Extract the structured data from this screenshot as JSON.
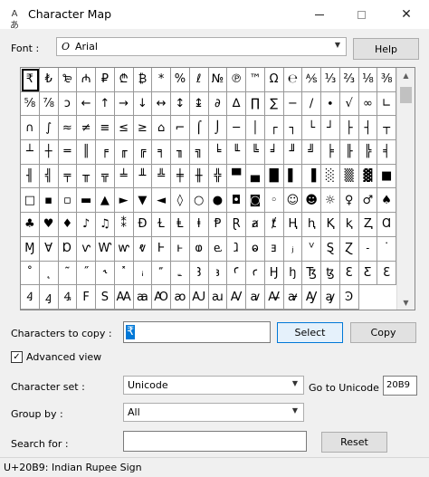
{
  "window": {
    "title": "Character Map",
    "icon": "character-map-icon",
    "controls": [
      "minimize",
      "maximize",
      "close"
    ]
  },
  "font_row": {
    "label": "Font :",
    "font_icon": "O",
    "value": "Arial",
    "help_label": "Help"
  },
  "grid": {
    "selected_index": 0,
    "rows": [
      [
        "₹",
        "₺",
        "₻",
        "₼",
        "₽",
        "₾",
        "₿",
        "*",
        "%",
        "ℓ",
        "№",
        "℗",
        "™",
        "Ω",
        "℮",
        "⅍",
        "⅓",
        "⅔",
        "⅛"
      ],
      [
        "⅜",
        "⅝",
        "⅞",
        "ↄ",
        "←",
        "↑",
        "→",
        "↓",
        "↔",
        "↕",
        "↨",
        "∂",
        "∆",
        "∏",
        "∑",
        "−",
        "∕",
        "∙",
        "√",
        "∞"
      ],
      [
        "∟",
        "∩",
        "∫",
        "≈",
        "≠",
        "≡",
        "≤",
        "≥",
        "⌂",
        "⌐",
        "⌠",
        "⌡",
        "─",
        "│",
        "┌",
        "┐",
        "└",
        "┘",
        "├",
        "┤"
      ],
      [
        "┬",
        "┴",
        "┼",
        "═",
        "║",
        "╒",
        "╓",
        "╔",
        "╕",
        "╖",
        "╗",
        "╘",
        "╙",
        "╚",
        "╛",
        "╜",
        "╝",
        "╞",
        "╟",
        "╠"
      ],
      [
        "╡",
        "╢",
        "╣",
        "╤",
        "╥",
        "╦",
        "╧",
        "╨",
        "╩",
        "╪",
        "╫",
        "╬",
        "▀",
        "▄",
        "█",
        "▌",
        "▐",
        "░",
        "▒",
        "▓"
      ],
      [
        "■",
        "□",
        "▪",
        "▫",
        "▬",
        "▲",
        "►",
        "▼",
        "◄",
        "◊",
        "○",
        "●",
        "◘",
        "◙",
        "◦",
        "☺",
        "☻",
        "☼",
        "♀"
      ],
      [
        "♂",
        "♠",
        "♣",
        "♥",
        "♦",
        "♪",
        "♫",
        "⁑",
        "Ɖ",
        "Ɫ",
        "Ⱡ",
        "ⱡ",
        "Ᵽ",
        "Ɽ",
        "ⱥ",
        "ⱦ",
        "Ⱨ",
        "ⱨ",
        "Ⱪ",
        "ⱪ"
      ],
      [
        "Ⱬ",
        "Ɑ",
        "Ɱ",
        "Ɐ",
        "Ɒ",
        "ⱱ",
        "Ⱳ",
        "ⱳ",
        "ⱴ",
        "Ⱶ",
        "ⱶ",
        "ⱷ",
        "ⱸ",
        "ⱹ",
        "ⱺ",
        "ⱻ",
        "ⱼ",
        "ⱽ",
        "Ȿ",
        "Ɀ"
      ],
      [
        "˗",
        "˙",
        "˚",
        "˛",
        "˜",
        "˝",
        "˞",
        "˟",
        "ꜟ",
        "꜠",
        "꜡",
        "Ꜣ",
        "ꜣ",
        "Ꜥ",
        "ꜥ",
        "Ꜧ",
        "ꜧ",
        "Ꜩ",
        "ꜩ",
        "Ꜫ"
      ],
      [
        "Ƹ",
        "Ɛ",
        "Ꜭ",
        "ꜭ",
        "Ꜯ",
        "F",
        "S",
        "Ꜳ",
        "ꜳ",
        "Ꜵ",
        "ꜵ",
        "Ꜷ",
        "ꜷ",
        "Ꜹ",
        "ꜹ",
        "Ꜻ",
        "ꜻ",
        "Ꜽ",
        "ꜽ",
        "Ꜿ"
      ]
    ]
  },
  "copy_row": {
    "label": "Characters to copy :",
    "value": "₹",
    "select_label": "Select",
    "copy_label": "Copy"
  },
  "advanced_view": {
    "label": "Advanced view",
    "checked": true,
    "check_glyph": "✓"
  },
  "character_set": {
    "label": "Character set :",
    "value": "Unicode",
    "goto_label": "Go to Unicode :",
    "goto_value": "20B9"
  },
  "group_by": {
    "label": "Group by :",
    "value": "All"
  },
  "search": {
    "label": "Search for :",
    "value": "",
    "reset_label": "Reset"
  },
  "status": {
    "text": "U+20B9: Indian Rupee Sign"
  },
  "glyphs": {
    "dropdown_arrow": "▼",
    "scroll_up": "▲",
    "scroll_down": "▼",
    "close": "✕"
  }
}
